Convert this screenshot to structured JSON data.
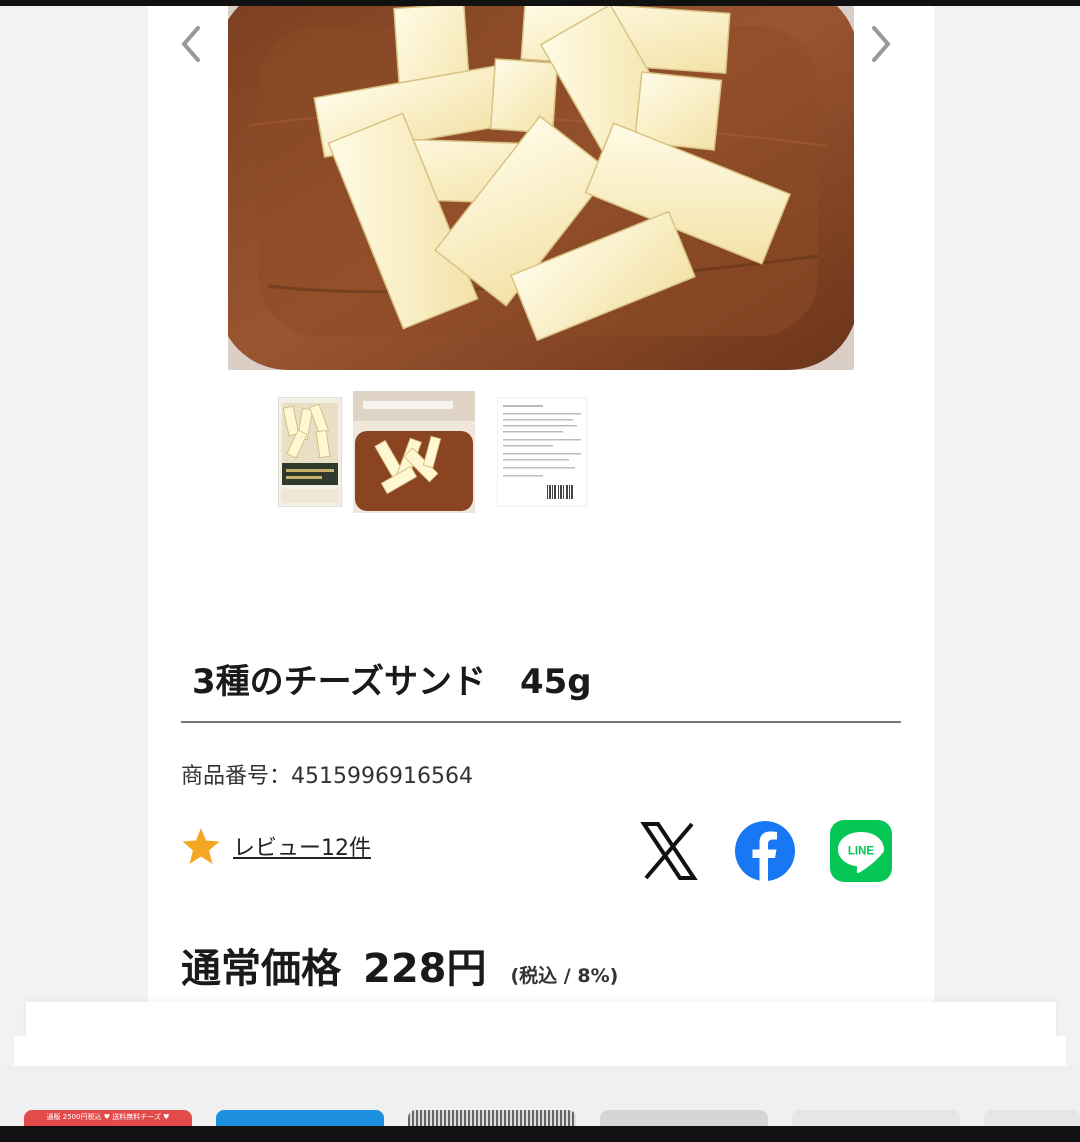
{
  "gallery": {
    "prev_label": "‹",
    "next_label": "›",
    "thumbnails": [
      "thumbnail-package",
      "thumbnail-plate",
      "thumbnail-label"
    ]
  },
  "product": {
    "title": "3種のチーズサンド　45g",
    "sku_label": "商品番号：",
    "sku_value": "4515996916564",
    "review_label": "レビュー12件"
  },
  "share": {
    "icons": [
      "x-logo-icon",
      "facebook-logo-icon",
      "line-logo-icon"
    ],
    "line_text": "LINE",
    "facebook_color": "#1877f2",
    "line_color": "#06c755"
  },
  "price": {
    "label": "通常価格",
    "value": "228円",
    "tax_note": "(税込 / 8%)"
  },
  "colors": {
    "star": "#f5a623",
    "banner_red": "#e34b4b",
    "banner_blue": "#1e90e0"
  },
  "banners": [
    {
      "text": "通販 2500円税込 ♥ 送料無料チーズ ♥"
    },
    {
      "text": ""
    },
    {
      "text": ""
    },
    {
      "text": ""
    },
    {
      "text": ""
    },
    {
      "text": ""
    }
  ]
}
